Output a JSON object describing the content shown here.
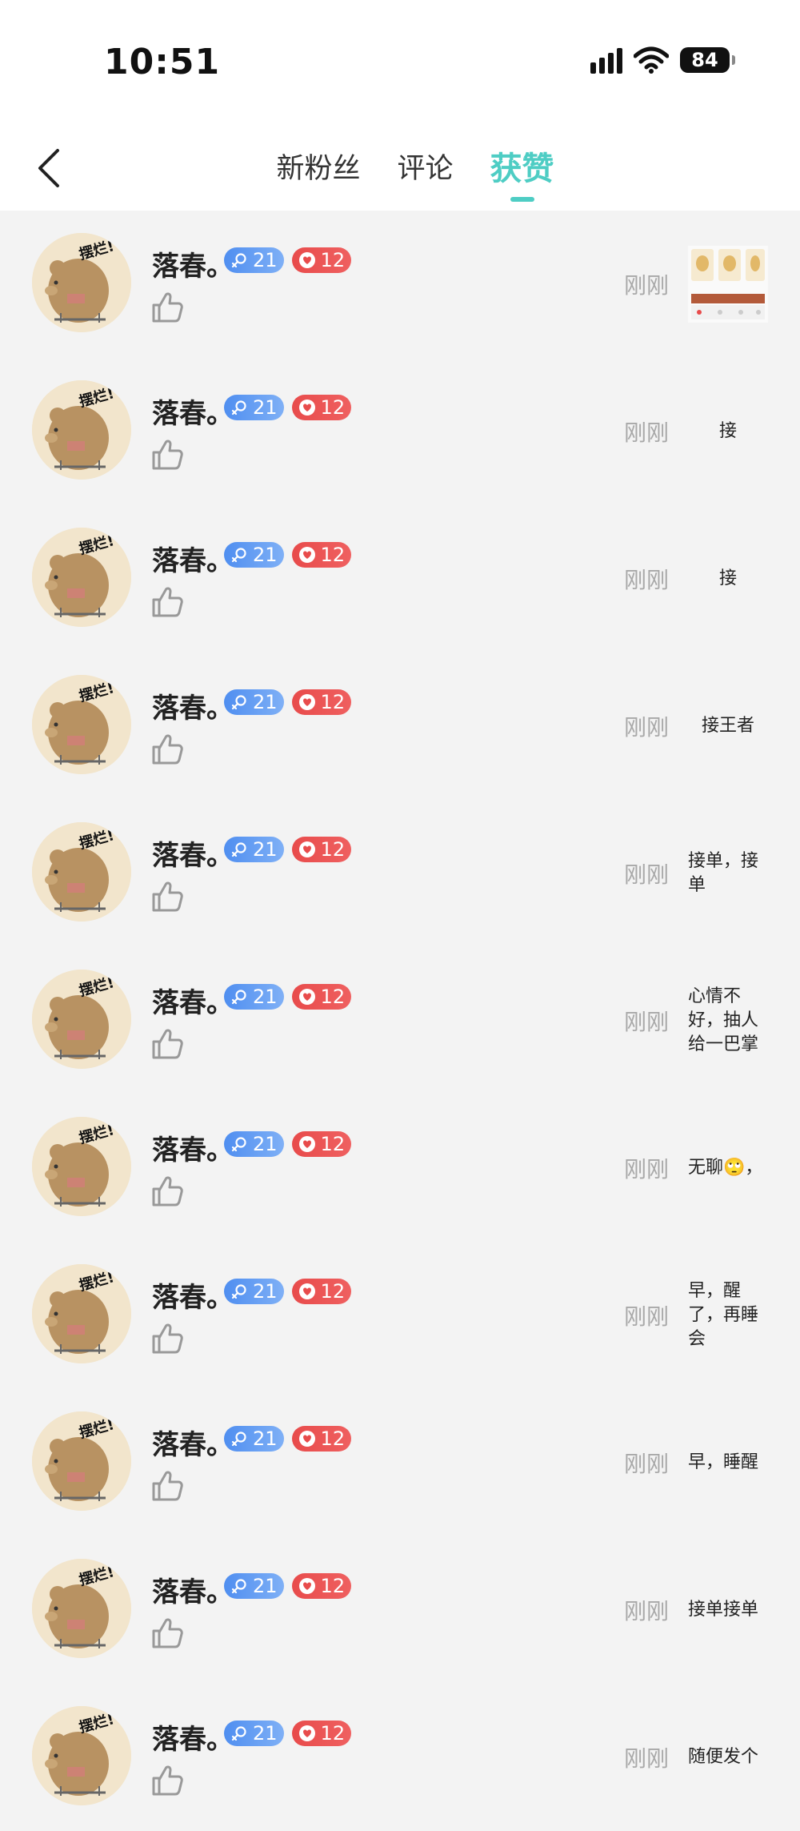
{
  "status_bar": {
    "time": "10:51",
    "battery": "84"
  },
  "header": {
    "tabs": [
      {
        "label": "新粉丝",
        "active": false
      },
      {
        "label": "评论",
        "active": false
      },
      {
        "label": "获赞",
        "active": true
      }
    ],
    "accent_color": "#4ecdc4"
  },
  "colors": {
    "gender_badge": "#4f8ef0",
    "charm_badge": "#e84b4b",
    "time_text": "#a8a8a8"
  },
  "items": [
    {
      "user": "落春。",
      "gender_level": "21",
      "charm_level": "12",
      "time": "刚刚",
      "preview": "",
      "preview_type": "image"
    },
    {
      "user": "落春。",
      "gender_level": "21",
      "charm_level": "12",
      "time": "刚刚",
      "preview": "接"
    },
    {
      "user": "落春。",
      "gender_level": "21",
      "charm_level": "12",
      "time": "刚刚",
      "preview": "接"
    },
    {
      "user": "落春。",
      "gender_level": "21",
      "charm_level": "12",
      "time": "刚刚",
      "preview": "接王者"
    },
    {
      "user": "落春。",
      "gender_level": "21",
      "charm_level": "12",
      "time": "刚刚",
      "preview": "接单，接单"
    },
    {
      "user": "落春。",
      "gender_level": "21",
      "charm_level": "12",
      "time": "刚刚",
      "preview": "心情不好，抽人给一巴掌"
    },
    {
      "user": "落春。",
      "gender_level": "21",
      "charm_level": "12",
      "time": "刚刚",
      "preview": "无聊🙄，"
    },
    {
      "user": "落春。",
      "gender_level": "21",
      "charm_level": "12",
      "time": "刚刚",
      "preview": "早，醒了，再睡会"
    },
    {
      "user": "落春。",
      "gender_level": "21",
      "charm_level": "12",
      "time": "刚刚",
      "preview": "早，睡醒"
    },
    {
      "user": "落春。",
      "gender_level": "21",
      "charm_level": "12",
      "time": "刚刚",
      "preview": "接单接单"
    },
    {
      "user": "落春。",
      "gender_level": "21",
      "charm_level": "12",
      "time": "刚刚",
      "preview": "随便发个"
    }
  ]
}
